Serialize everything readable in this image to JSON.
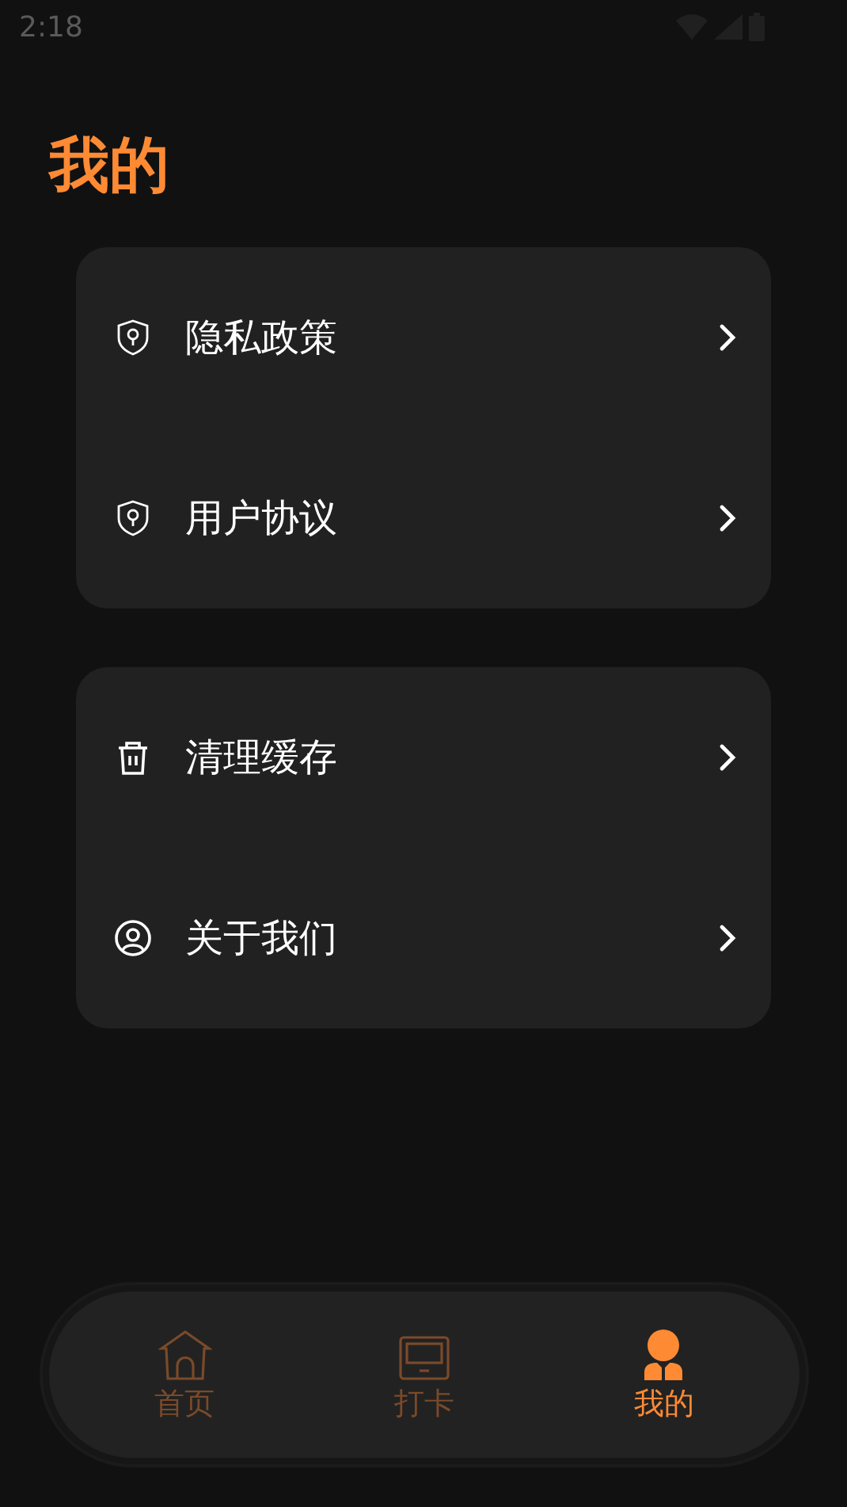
{
  "status_bar": {
    "time": "2:18"
  },
  "page_title": "我的",
  "groups": [
    {
      "items": [
        {
          "kind": "shield",
          "label": "隐私政策"
        },
        {
          "kind": "shield",
          "label": "用户协议"
        }
      ]
    },
    {
      "items": [
        {
          "kind": "trash",
          "label": "清理缓存"
        },
        {
          "kind": "user",
          "label": "关于我们"
        }
      ]
    }
  ],
  "bottom_nav": [
    {
      "kind": "home",
      "label": "首页",
      "selected": false
    },
    {
      "kind": "screen",
      "label": "打卡",
      "selected": false
    },
    {
      "kind": "person",
      "label": "我的",
      "selected": true
    }
  ]
}
